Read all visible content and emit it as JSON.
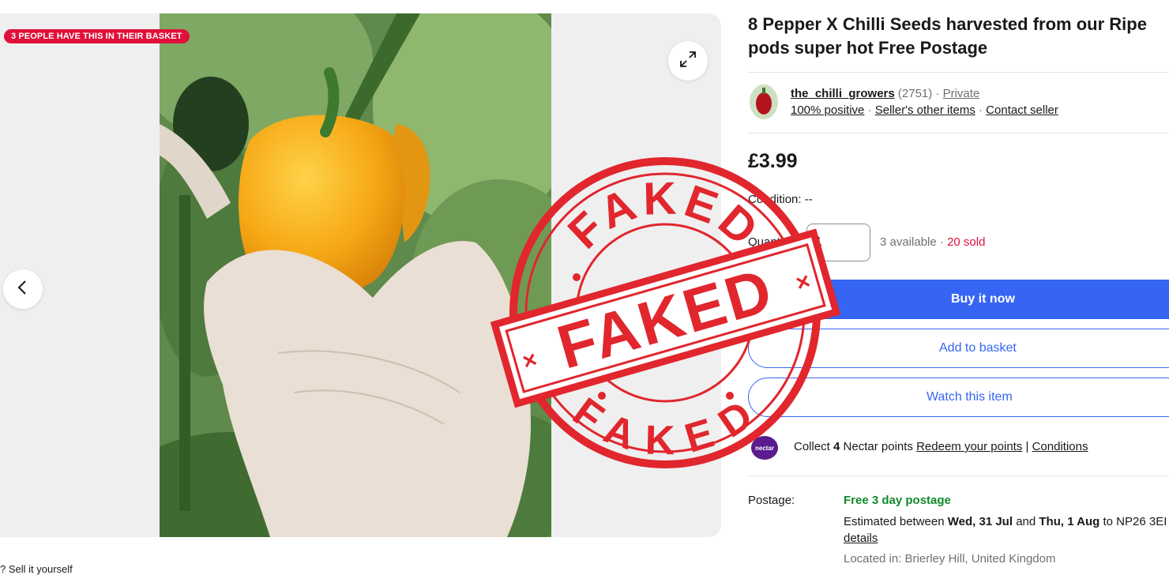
{
  "gallery": {
    "badge": "3 PEOPLE HAVE THIS IN THEIR BASKET",
    "sell_link": "? Sell it yourself"
  },
  "listing": {
    "title_line1": "8 Pepper X Chilli Seeds harvested from our Ripe",
    "title_line2": "pods super hot Free Postage"
  },
  "seller": {
    "name": "the_chilli_growers",
    "feedback_count": "(2751)",
    "type": "Private",
    "positive": "100% positive",
    "other_items": "Seller's other items",
    "contact": "Contact seller"
  },
  "price": "£3.99",
  "condition": {
    "label": "Condition:",
    "value": "--"
  },
  "quantity": {
    "label": "Quantity:",
    "value": "1",
    "available": "3 available",
    "sold": "20 sold"
  },
  "actions": {
    "buy": "Buy it now",
    "basket": "Add to basket",
    "watch": "Watch this item"
  },
  "nectar": {
    "logo": "nectar",
    "collect": "Collect",
    "points": "4",
    "collect_suffix": "Nectar points",
    "redeem": "Redeem your points",
    "separator": "|",
    "conditions": "Conditions"
  },
  "postage": {
    "label": "Postage:",
    "service": "Free 3 day postage",
    "est_prefix": "Estimated between",
    "date1": "Wed, 31 Jul",
    "and": "and",
    "date2": "Thu, 1 Aug",
    "to": "to NP26 3EI",
    "details": "details",
    "located": "Located in: Brierley Hill, United Kingdom"
  },
  "stamp": {
    "top_text": "FAKED",
    "center_text": "FAKED",
    "bottom_text": "FAKED",
    "color": "#e1262d"
  },
  "colors": {
    "accent": "#3665f3",
    "badge": "#e0103a",
    "free_postage": "#118a2c"
  },
  "icons": {
    "expand": "expand-icon",
    "prev": "chevron-left-icon",
    "next": "chevron-right-icon"
  }
}
